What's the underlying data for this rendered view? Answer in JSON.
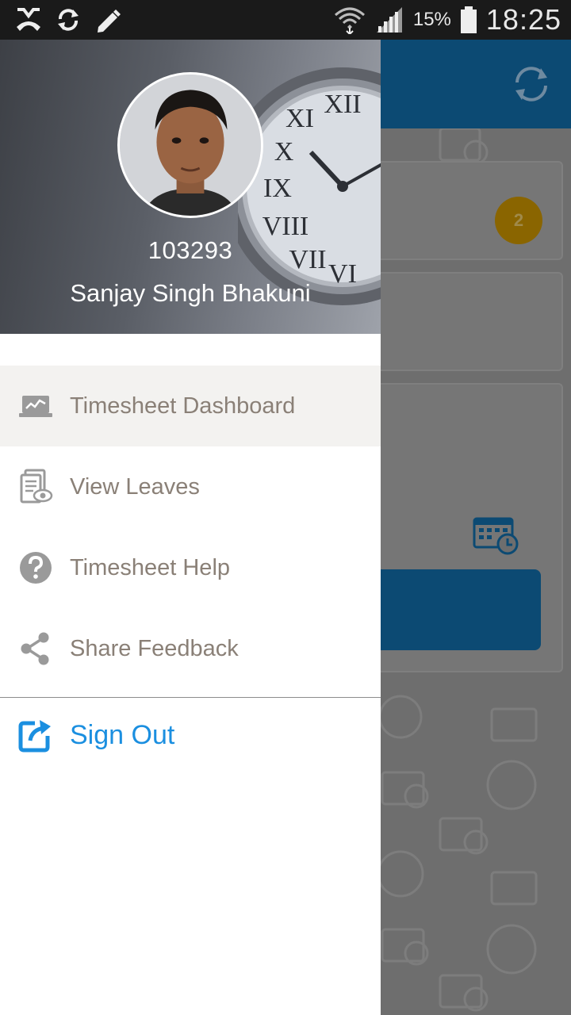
{
  "status_bar": {
    "battery_percent": "15%",
    "time": "18:25",
    "icons": [
      "missed-call-icon",
      "sync-icon",
      "pencil-icon",
      "wifi-icon",
      "signal-icon",
      "battery-icon"
    ]
  },
  "drawer": {
    "user": {
      "employee_id": "103293",
      "name": "Sanjay Singh Bhakuni"
    },
    "menu": [
      {
        "label": "Timesheet Dashboard",
        "icon": "laptop-chart-icon",
        "active": true
      },
      {
        "label": "View Leaves",
        "icon": "document-eye-icon",
        "active": false
      },
      {
        "label": "Timesheet Help",
        "icon": "help-circle-icon",
        "active": false
      },
      {
        "label": "Share Feedback",
        "icon": "share-icon",
        "active": false
      }
    ],
    "sign_out": {
      "label": "Sign Out",
      "icon": "sign-out-icon"
    }
  },
  "background": {
    "badge_count": "2"
  },
  "colors": {
    "accent": "#1b8fe0",
    "app_bar": "#0c4a73",
    "badge": "#f0a000",
    "menu_text": "#8a8077",
    "active_item_bg": "#f3f2f0"
  }
}
